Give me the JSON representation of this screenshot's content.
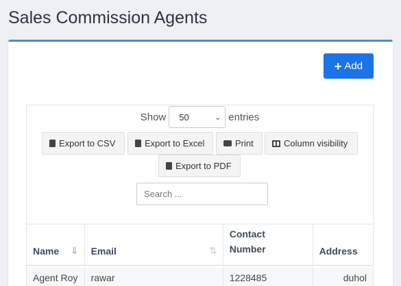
{
  "page": {
    "title": "Sales Commission Agents"
  },
  "toolbar": {
    "add_label": "Add"
  },
  "length": {
    "show_label": "Show",
    "entries_label": "entries",
    "selected": "50"
  },
  "export_buttons": [
    {
      "label": "Export to CSV",
      "icon": "csv-file-icon"
    },
    {
      "label": "Export to Excel",
      "icon": "excel-file-icon"
    },
    {
      "label": "Print",
      "icon": "print-icon"
    },
    {
      "label": "Column visibility",
      "icon": "columns-icon"
    },
    {
      "label": "Export to PDF",
      "icon": "pdf-file-icon"
    }
  ],
  "search": {
    "placeholder": "Search ..."
  },
  "table": {
    "headers": {
      "name": "Name",
      "email": "Email",
      "contact_line1": "Contact",
      "contact_line2": "Number",
      "address": "Address"
    },
    "rows": [
      {
        "name": "Agent Roy",
        "email": "rawar",
        "contact": "1228485",
        "address": "duhol"
      }
    ]
  }
}
